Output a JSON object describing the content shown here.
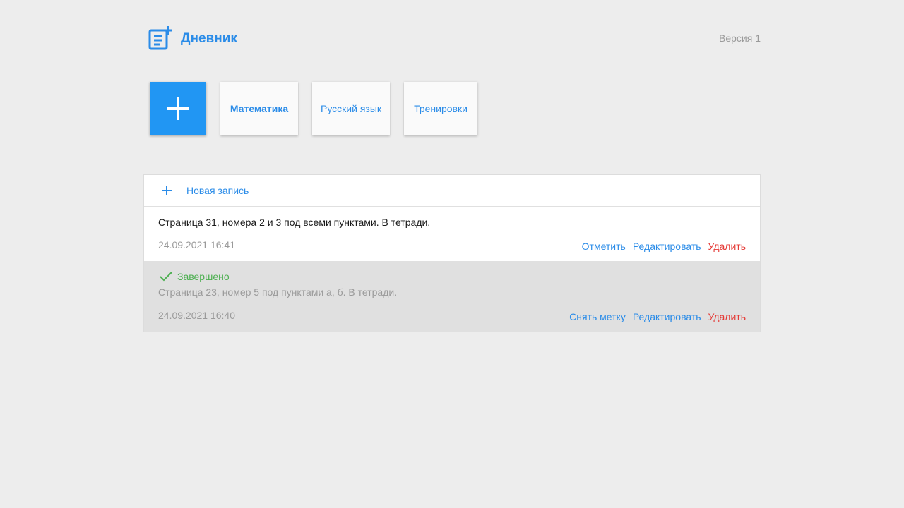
{
  "header": {
    "title": "Дневник",
    "version": "Версия 1"
  },
  "tabs": [
    {
      "label": "Математика",
      "active": true
    },
    {
      "label": "Русский язык",
      "active": false
    },
    {
      "label": "Тренировки",
      "active": false
    }
  ],
  "panel": {
    "new_entry_label": "Новая запись",
    "entries": [
      {
        "text": "Страница 31, номера 2 и 3 под всеми пунктами. В тетради.",
        "date": "24.09.2021 16:41",
        "actions": {
          "mark": "Отметить",
          "edit": "Редактировать",
          "delete": "Удалить"
        }
      },
      {
        "status": "Завершено",
        "text": "Страница 23, номер 5 под пунктами а, б. В тетради.",
        "date": "24.09.2021 16:40",
        "actions": {
          "mark": "Снять метку",
          "edit": "Редактировать",
          "delete": "Удалить"
        }
      }
    ]
  },
  "colors": {
    "accent": "#2196f3",
    "link": "#2b8ce8",
    "danger": "#e53935",
    "success": "#4caf50",
    "background": "#ededed"
  },
  "icons": [
    "notebook-add-icon",
    "plus-icon",
    "check-icon"
  ]
}
